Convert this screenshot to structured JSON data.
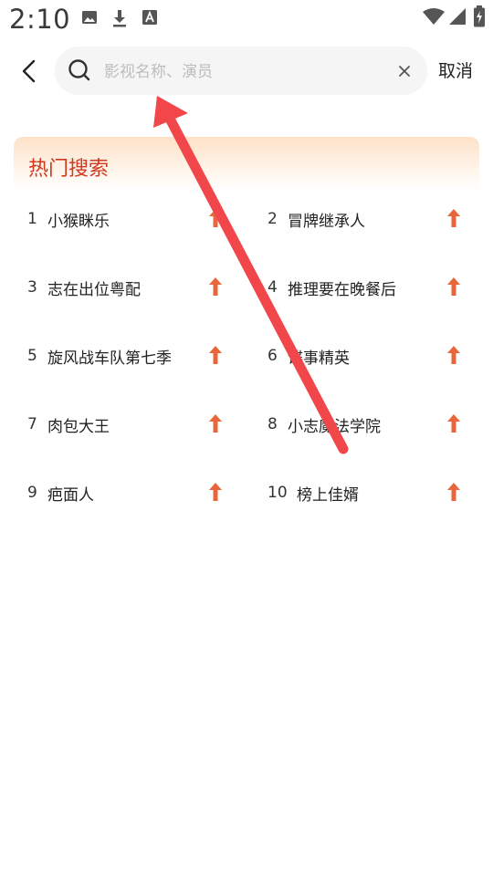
{
  "status_bar": {
    "time": "2:10",
    "left_icons": [
      "image-icon",
      "download-icon",
      "font-a-icon"
    ],
    "right_icons": [
      "wifi-icon",
      "signal-icon",
      "battery-charging-icon"
    ]
  },
  "search": {
    "placeholder": "影视名称、演员",
    "value": "",
    "cancel_label": "取消"
  },
  "hot_search": {
    "title": "热门搜索",
    "items": [
      {
        "rank": "1",
        "name": "小猴眯乐"
      },
      {
        "rank": "2",
        "name": "冒牌继承人"
      },
      {
        "rank": "3",
        "name": "志在出位粤配"
      },
      {
        "rank": "4",
        "name": "推理要在晚餐后"
      },
      {
        "rank": "5",
        "name": "旋风战车队第七季"
      },
      {
        "rank": "6",
        "name": "谍事精英"
      },
      {
        "rank": "7",
        "name": "肉包大王"
      },
      {
        "rank": "8",
        "name": "小志魔法学院"
      },
      {
        "rank": "9",
        "name": "疤面人"
      },
      {
        "rank": "10",
        "name": "榜上佳婿"
      }
    ]
  },
  "colors": {
    "accent_red": "#d2371f",
    "trend_orange": "#e8663a",
    "panel_gradient_top": "#fde1c6",
    "annotation_arrow": "#f2474a"
  }
}
